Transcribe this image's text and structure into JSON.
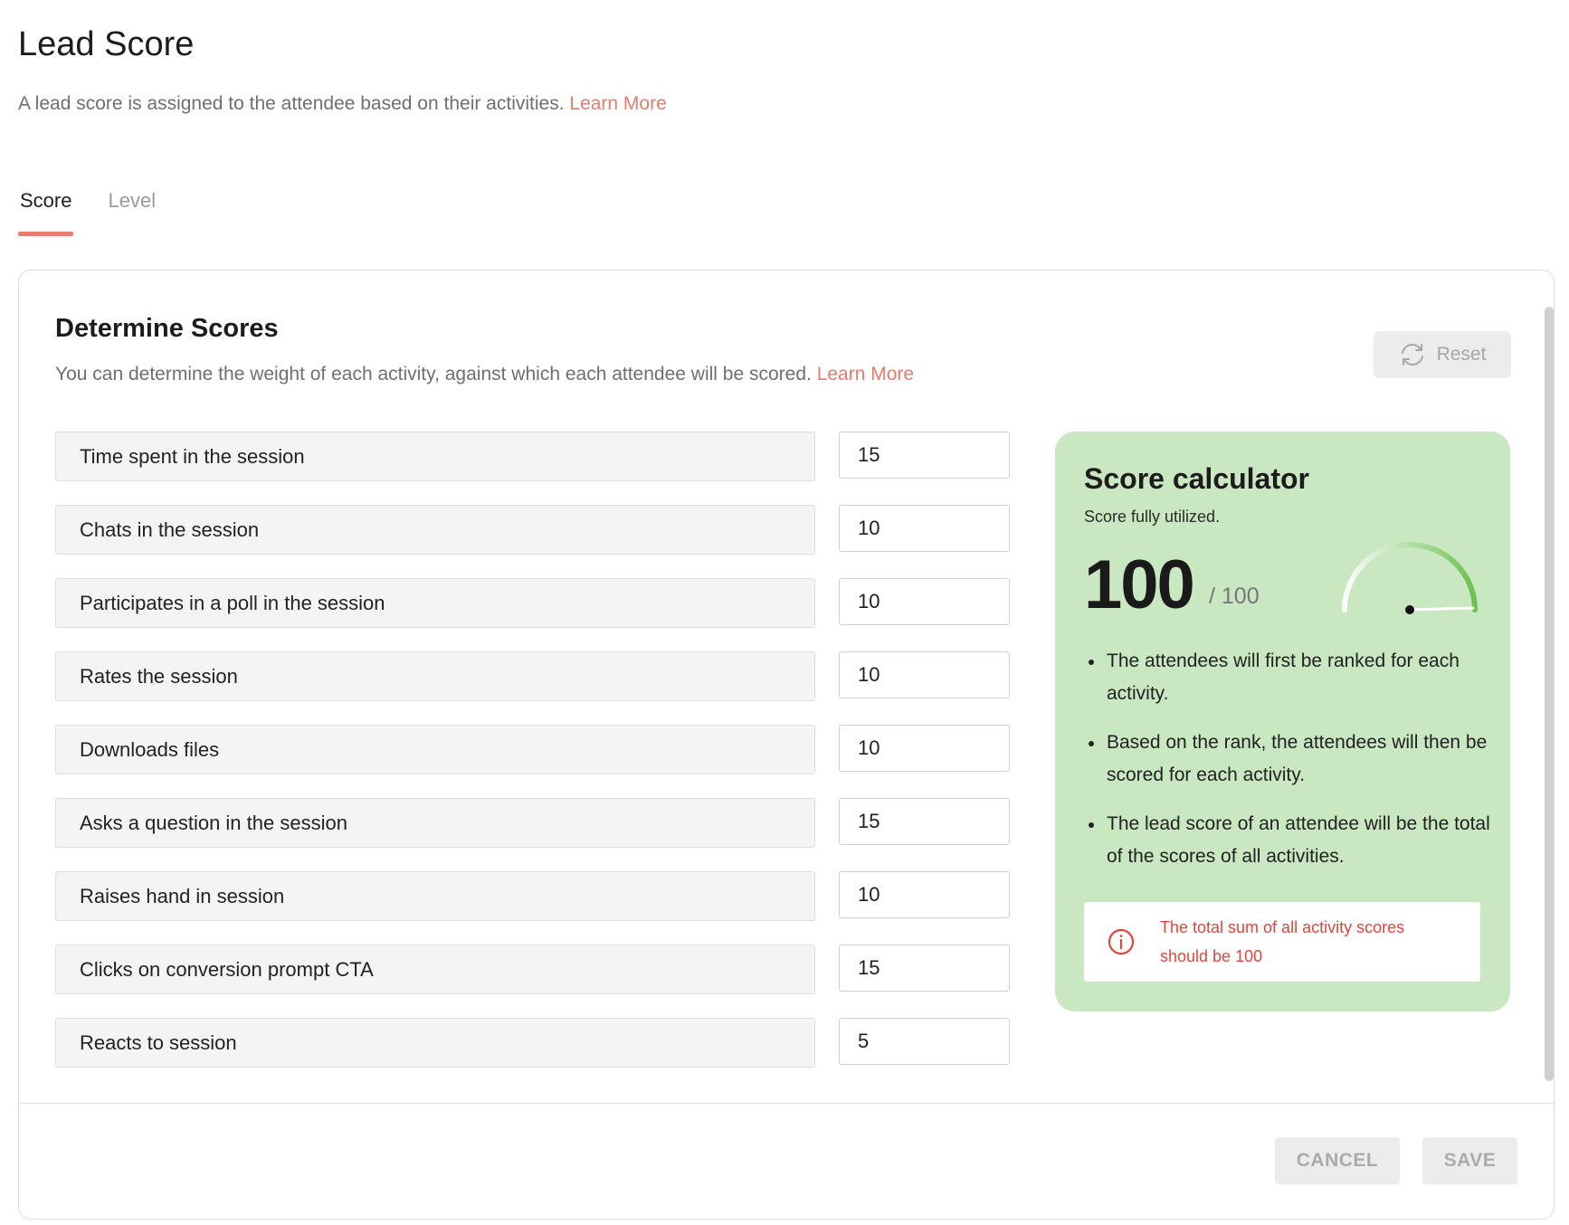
{
  "header": {
    "title": "Lead Score",
    "subtitle": "A lead score is assigned to the attendee based on their activities.",
    "learn_more": "Learn More"
  },
  "tabs": [
    {
      "label": "Score",
      "active": true
    },
    {
      "label": "Level",
      "active": false
    }
  ],
  "section": {
    "title": "Determine Scores",
    "description": "You can determine the weight of each activity, against which each attendee will be scored.",
    "learn_more": "Learn More",
    "reset_label": "Reset"
  },
  "activities": [
    {
      "label": "Time spent in the session",
      "value": "15"
    },
    {
      "label": "Chats in the session",
      "value": "10"
    },
    {
      "label": "Participates in a poll in the session",
      "value": "10"
    },
    {
      "label": "Rates the session",
      "value": "10"
    },
    {
      "label": "Downloads files",
      "value": "10"
    },
    {
      "label": "Asks a question in the session",
      "value": "15"
    },
    {
      "label": "Raises hand in session",
      "value": "10"
    },
    {
      "label": "Clicks on conversion prompt CTA",
      "value": "15"
    },
    {
      "label": "Reacts to session",
      "value": "5"
    }
  ],
  "calculator": {
    "title": "Score calculator",
    "status": "Score fully utilized.",
    "score": "100",
    "max": "/ 100",
    "gauge_fraction": 1.0,
    "bullets": [
      "The attendees will first be ranked for each activity.",
      "Based on the rank, the attendees will then be scored for each activity.",
      "The lead score of an attendee will be the total of the scores of all activities."
    ],
    "warning": "The total sum of all activity scores should be 100"
  },
  "footer": {
    "cancel_label": "CANCEL",
    "save_label": "SAVE"
  },
  "colors": {
    "accent": "#e57c6e",
    "calculator_bg": "#c9e7c1",
    "gauge_green": "#6cbf4f",
    "warning": "#e0473c"
  },
  "icons": {
    "reset": "refresh-icon",
    "warning": "info-circle-icon",
    "gauge": "gauge-icon"
  }
}
